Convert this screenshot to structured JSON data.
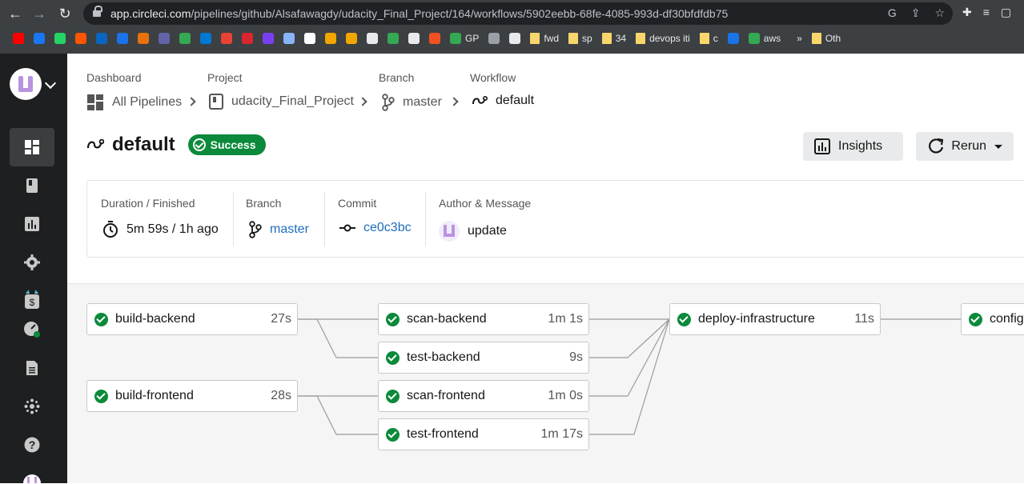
{
  "browser": {
    "url_host": "app.circleci.com",
    "url_path": "/pipelines/github/Alsafawagdy/udacity_Final_Project/164/workflows/5902eebb-68fe-4085-993d-df30bfdfdb75",
    "bookmarks": [
      {
        "label": "",
        "icon": "youtube-icon",
        "color": "#ff0000"
      },
      {
        "label": "",
        "icon": "facebook-icon",
        "color": "#1877f2"
      },
      {
        "label": "",
        "icon": "whatsapp-icon",
        "color": "#25d366"
      },
      {
        "label": "",
        "icon": "soundcloud-icon",
        "color": "#ff5500"
      },
      {
        "label": "",
        "icon": "linkedin-icon",
        "color": "#0a66c2"
      },
      {
        "label": "",
        "icon": "globe-icon",
        "color": "#1a73e8"
      },
      {
        "label": "",
        "icon": "in-icon",
        "color": "#e8710a"
      },
      {
        "label": "",
        "icon": "teams-icon",
        "color": "#6264a7"
      },
      {
        "label": "",
        "icon": "drive-icon",
        "color": "#34a853"
      },
      {
        "label": "",
        "icon": "outlook-icon",
        "color": "#0078d4"
      },
      {
        "label": "",
        "icon": "gmail-icon",
        "color": "#ea4335"
      },
      {
        "label": "",
        "icon": "mega-icon",
        "color": "#d9272e"
      },
      {
        "label": "",
        "icon": "arrow-icon",
        "color": "#7b3ff2"
      },
      {
        "label": "",
        "icon": "chart-icon",
        "color": "#8ab4f8"
      },
      {
        "label": "",
        "icon": "google-icon",
        "color": "#ffffff"
      },
      {
        "label": "",
        "icon": "infinity-icon",
        "color": "#f2a600"
      },
      {
        "label": "",
        "icon": "infinity-icon",
        "color": "#f2a600"
      },
      {
        "label": "",
        "icon": "box-icon",
        "color": "#e8eaed"
      },
      {
        "label": "",
        "icon": "drive-icon",
        "color": "#34a853"
      },
      {
        "label": "",
        "icon": "face-icon",
        "color": "#e8eaed"
      },
      {
        "label": "",
        "icon": "microsoft-icon",
        "color": "#f25022"
      },
      {
        "label": "GP",
        "icon": "drive-icon",
        "color": "#34a853"
      },
      {
        "label": "",
        "icon": "pen-icon",
        "color": "#9aa0a6"
      },
      {
        "label": "",
        "icon": "github-icon",
        "color": "#e8eaed"
      },
      {
        "label": "fwd",
        "icon": "folder-icon",
        "color": "#f9d66b"
      },
      {
        "label": "sp",
        "icon": "folder-icon",
        "color": "#f9d66b"
      },
      {
        "label": "34",
        "icon": "folder-icon",
        "color": "#f9d66b"
      },
      {
        "label": "devops iti",
        "icon": "folder-icon",
        "color": "#f9d66b"
      },
      {
        "label": "c",
        "icon": "folder-icon",
        "color": "#f9d66b"
      },
      {
        "label": "",
        "icon": "play-icon",
        "color": "#1a73e8"
      },
      {
        "label": "aws",
        "icon": "drive-icon",
        "color": "#34a853"
      }
    ],
    "more_label": "»",
    "other_label": "Oth"
  },
  "breadcrumb": {
    "dashboard_label": "Dashboard",
    "dashboard_value": "All Pipelines",
    "project_label": "Project",
    "project_value": "udacity_Final_Project",
    "branch_label": "Branch",
    "branch_value": "master",
    "workflow_label": "Workflow",
    "workflow_value": "default"
  },
  "header": {
    "title": "default",
    "status": "Success",
    "insights_label": "Insights",
    "rerun_label": "Rerun"
  },
  "summary": {
    "duration_label": "Duration / Finished",
    "duration_value": "5m 59s / 1h ago",
    "branch_label": "Branch",
    "branch_value": "master",
    "commit_label": "Commit",
    "commit_value": "ce0c3bc",
    "author_label": "Author & Message",
    "author_value": "update"
  },
  "jobs": [
    {
      "name": "build-backend",
      "duration": "27s"
    },
    {
      "name": "build-frontend",
      "duration": "28s"
    },
    {
      "name": "scan-backend",
      "duration": "1m 1s"
    },
    {
      "name": "test-backend",
      "duration": "9s"
    },
    {
      "name": "scan-frontend",
      "duration": "1m 0s"
    },
    {
      "name": "test-frontend",
      "duration": "1m 17s"
    },
    {
      "name": "deploy-infrastructure",
      "duration": "11s"
    },
    {
      "name": "configure-infrastructure",
      "duration": ""
    }
  ],
  "colors": {
    "success": "#0a8a3a",
    "link": "#1d6dbd",
    "sidebar": "#1e1f20",
    "avatar_accent": "#b993e0"
  }
}
